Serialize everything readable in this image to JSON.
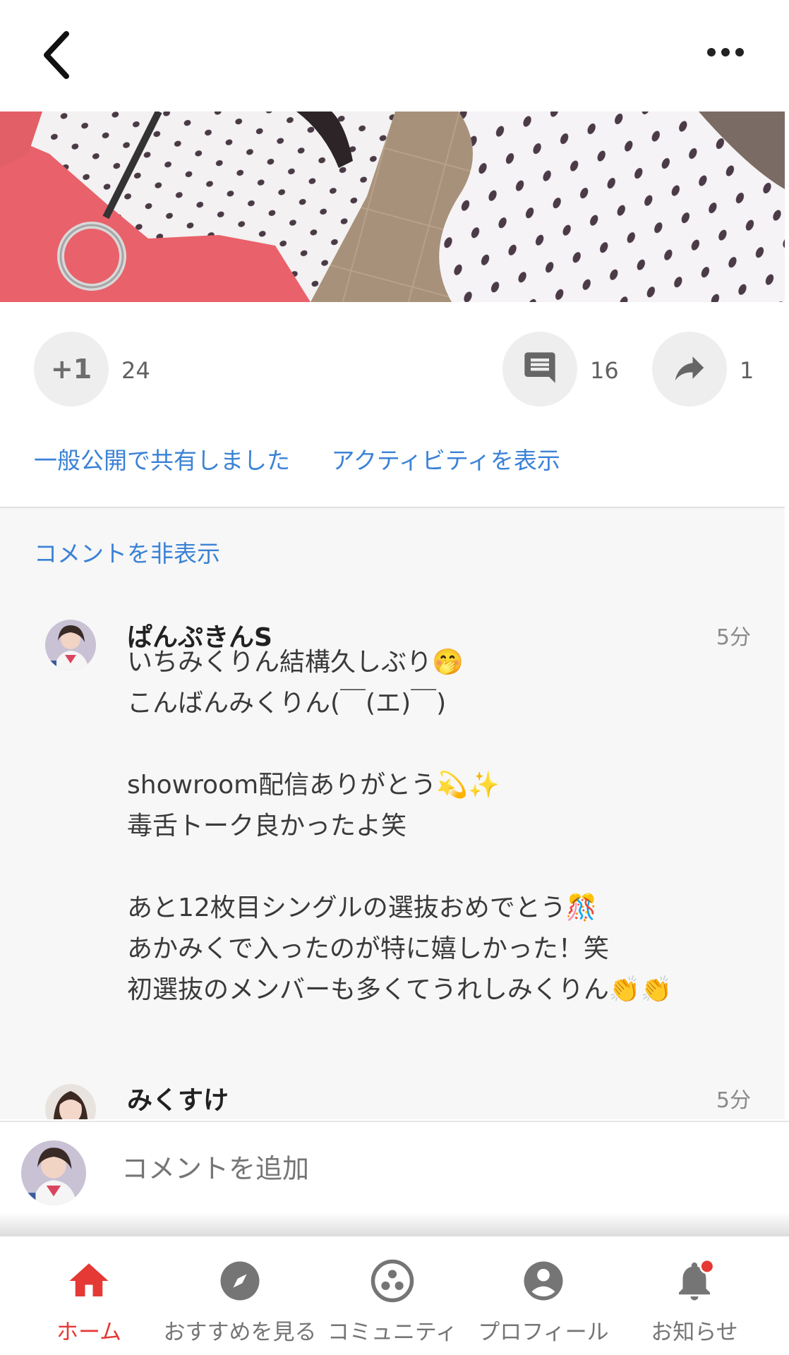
{
  "header": {
    "back_icon": "back-chevron-icon",
    "more_icon": "more-horizontal-icon"
  },
  "actions": {
    "plus_one_label": "+1",
    "plus_one_count": "24",
    "comment_count": "16",
    "share_count": "1"
  },
  "links": {
    "shared_publicly": "一般公開で共有しました",
    "show_activity": "アクティビティを表示"
  },
  "comments": {
    "hide_label": "コメントを非表示",
    "items": [
      {
        "author": "ぱんぷきんS",
        "time": "5分",
        "lines": [
          "いちみくりん結構久しぶり🤭",
          "こんばんみくりん(￣(エ)￣)",
          "",
          "showroom配信ありがとう💫✨",
          "毒舌トーク良かったよ笑",
          "",
          "あと12枚目シングルの選抜おめでとう🎊",
          "あかみくで入ったのが特に嬉しかった！笑",
          "初選抜のメンバーも多くてうれしみくりん👏👏"
        ]
      },
      {
        "author": "みくすけ",
        "time": "5分"
      }
    ]
  },
  "composer": {
    "placeholder": "コメントを追加"
  },
  "bottom_nav": {
    "items": [
      {
        "label": "ホーム",
        "icon": "home-icon",
        "active": true
      },
      {
        "label": "おすすめを見る",
        "icon": "compass-icon"
      },
      {
        "label": "コミュニティ",
        "icon": "community-icon"
      },
      {
        "label": "プロフィール",
        "icon": "profile-icon"
      },
      {
        "label": "お知らせ",
        "icon": "bell-icon"
      }
    ]
  },
  "colors": {
    "link": "#3b82d6",
    "active_nav": "#e53935",
    "notification_dot": "#e53935"
  }
}
